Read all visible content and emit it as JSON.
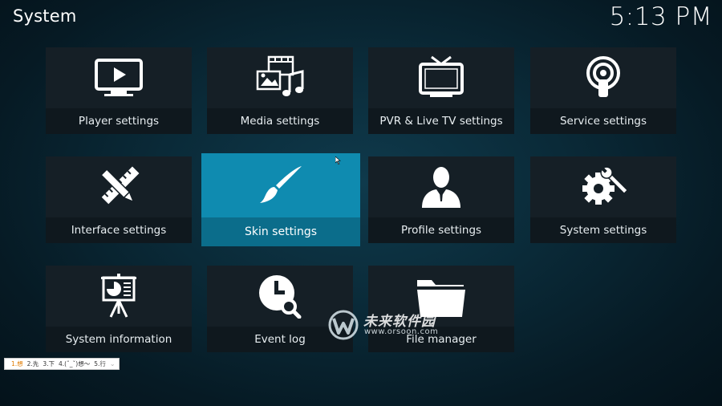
{
  "header": {
    "title": "System",
    "clock": "5:13 PM"
  },
  "tiles": [
    {
      "label": "Player settings",
      "icon": "player-settings-icon"
    },
    {
      "label": "Media settings",
      "icon": "media-settings-icon"
    },
    {
      "label": "PVR & Live TV settings",
      "icon": "pvr-tv-icon"
    },
    {
      "label": "Service settings",
      "icon": "service-podcast-icon"
    },
    {
      "label": "Interface settings",
      "icon": "interface-pencil-ruler-icon"
    },
    {
      "label": "Skin settings",
      "icon": "skin-paintbrush-icon",
      "focused": true
    },
    {
      "label": "Profile settings",
      "icon": "profile-person-icon"
    },
    {
      "label": "System settings",
      "icon": "system-gear-wrench-icon"
    },
    {
      "label": "System information",
      "icon": "system-info-presentation-icon"
    },
    {
      "label": "Event log",
      "icon": "event-log-clock-search-icon"
    },
    {
      "label": "File manager",
      "icon": "file-manager-folder-icon"
    }
  ],
  "ime": {
    "candidates": [
      "1.想",
      "2.先",
      "3.下",
      "4.(ˇ_ˇ)想～",
      "5.行"
    ],
    "arrow": "⌄"
  },
  "watermark": {
    "cn": "未来软件园",
    "url": "www.orsoon.com"
  },
  "colors": {
    "focus_tile": "#0f8bb0",
    "tile_bg": "#151f26",
    "tile_label_bg": "#0f181e",
    "background": "#0a2a38"
  }
}
